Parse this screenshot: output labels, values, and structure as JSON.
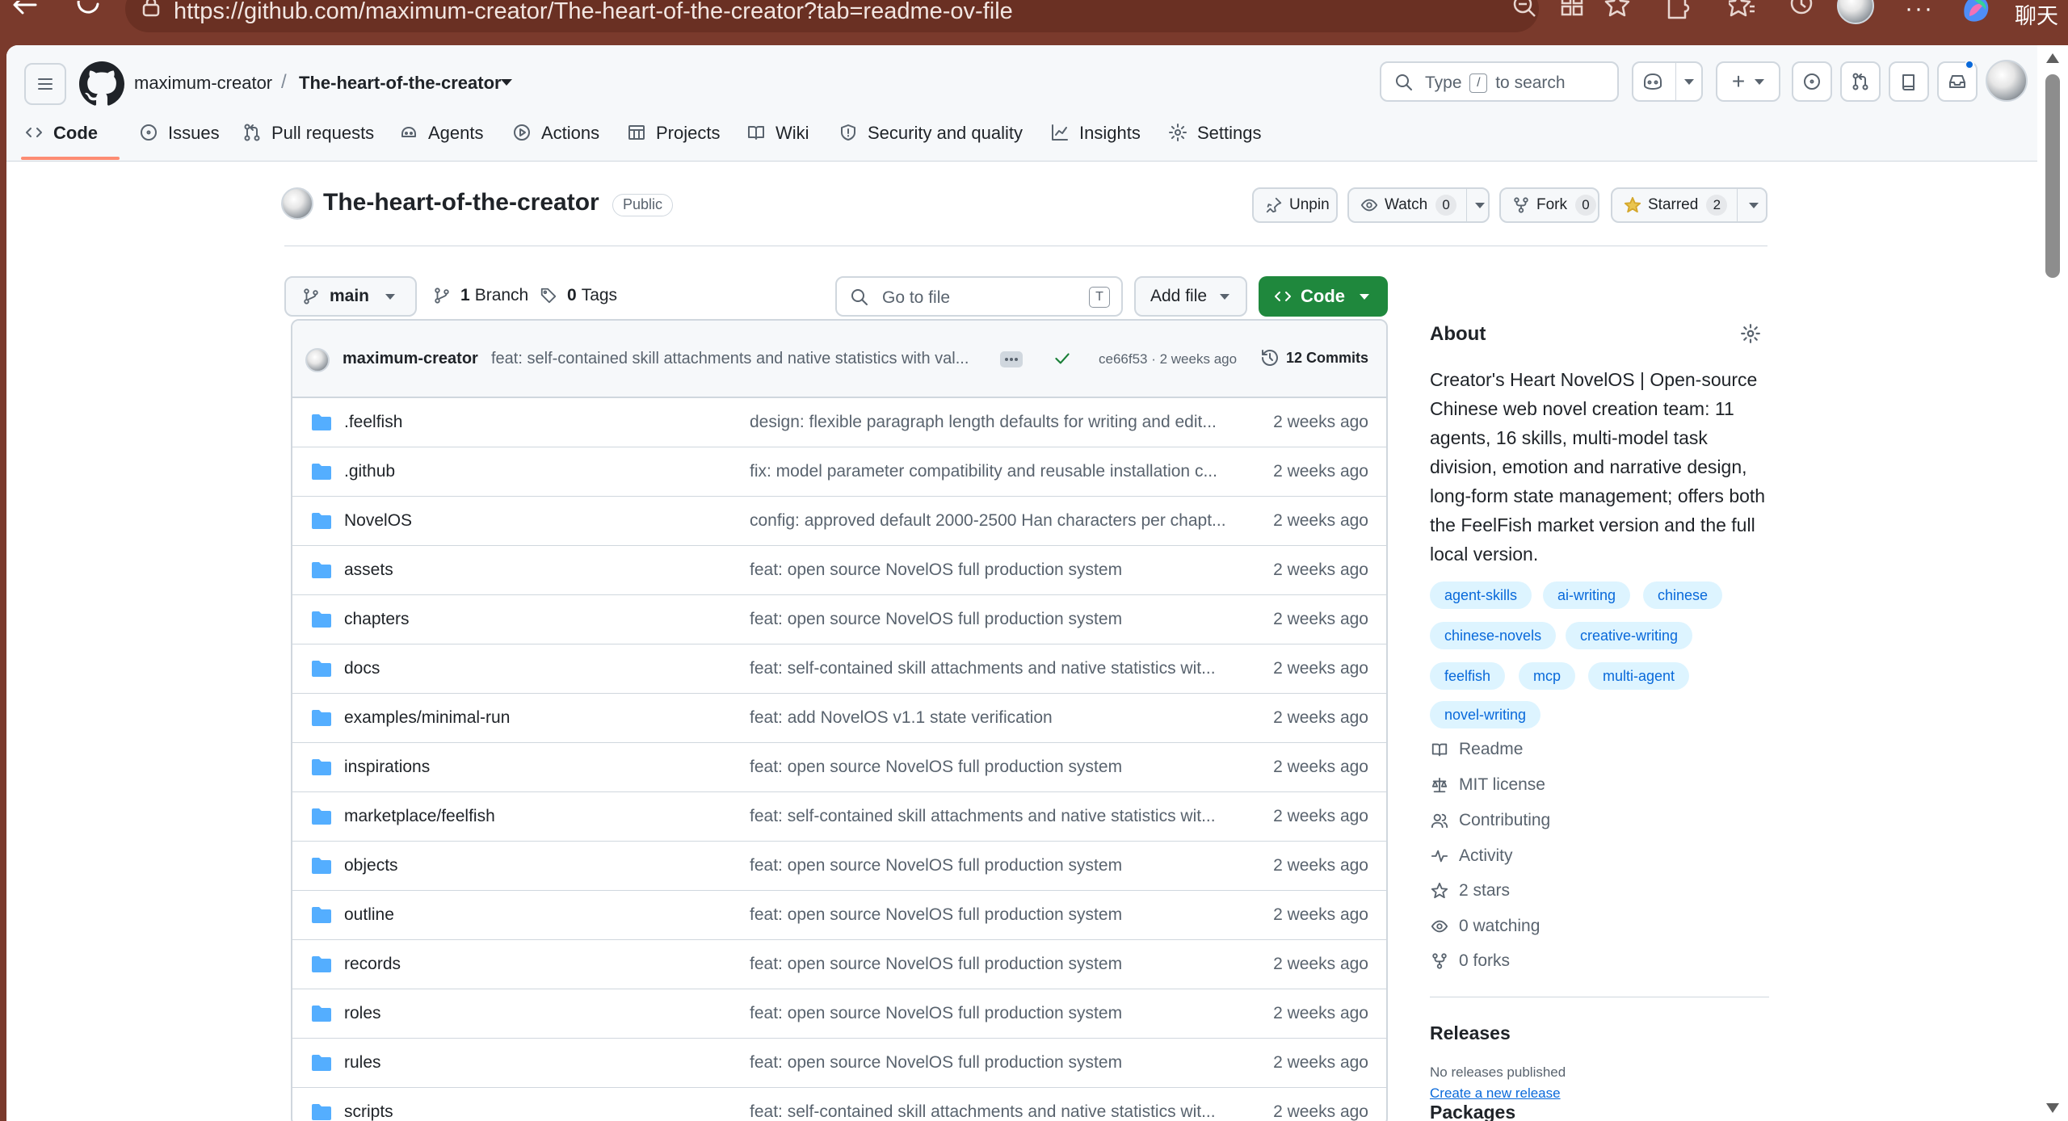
{
  "browser": {
    "url": "https://github.com/maximum-creator/The-heart-of-the-creator?tab=readme-ov-file",
    "chat_label": "聊天"
  },
  "header": {
    "owner": "maximum-creator",
    "separator": "/",
    "repo": "The-heart-of-the-creator",
    "search_prefix": "Type",
    "search_key": "/",
    "search_suffix": "to search"
  },
  "tabs": [
    {
      "label": "Code",
      "icon": "code-icon"
    },
    {
      "label": "Issues",
      "icon": "issue-icon"
    },
    {
      "label": "Pull requests",
      "icon": "pull-request-icon"
    },
    {
      "label": "Agents",
      "icon": "agents-icon"
    },
    {
      "label": "Actions",
      "icon": "play-icon"
    },
    {
      "label": "Projects",
      "icon": "table-icon"
    },
    {
      "label": "Wiki",
      "icon": "book-icon"
    },
    {
      "label": "Security and quality",
      "icon": "shield-icon"
    },
    {
      "label": "Insights",
      "icon": "graph-icon"
    },
    {
      "label": "Settings",
      "icon": "gear-icon"
    }
  ],
  "repo": {
    "title": "The-heart-of-the-creator",
    "visibility": "Public",
    "unpin_label": "Unpin",
    "watch_label": "Watch",
    "watch_count": "0",
    "fork_label": "Fork",
    "fork_count": "0",
    "starred_label": "Starred",
    "star_count": "2"
  },
  "branchbar": {
    "branch": "main",
    "branches": "1",
    "branches_label": "Branch",
    "tags": "0",
    "tags_label": "Tags",
    "goto_placeholder": "Go to file",
    "goto_key": "T",
    "add_file": "Add file",
    "code": "Code"
  },
  "latest_commit": {
    "user": "maximum-creator",
    "message": "feat: self-contained skill attachments and native statistics with val...",
    "hash": "ce66f53 · 2 weeks ago",
    "commits_count": "12",
    "commits_label": "Commits"
  },
  "files": [
    {
      "name": ".feelfish",
      "message": "design: flexible paragraph length defaults for writing and edit...",
      "time": "2 weeks ago"
    },
    {
      "name": ".github",
      "message": "fix: model parameter compatibility and reusable installation c...",
      "time": "2 weeks ago"
    },
    {
      "name": "NovelOS",
      "message": "config: approved default 2000-2500 Han characters per chapt...",
      "time": "2 weeks ago"
    },
    {
      "name": "assets",
      "message": "feat: open source NovelOS full production system",
      "time": "2 weeks ago"
    },
    {
      "name": "chapters",
      "message": "feat: open source NovelOS full production system",
      "time": "2 weeks ago"
    },
    {
      "name": "docs",
      "message": "feat: self-contained skill attachments and native statistics wit...",
      "time": "2 weeks ago"
    },
    {
      "name": "examples/minimal-run",
      "message": "feat: add NovelOS v1.1 state verification",
      "time": "2 weeks ago"
    },
    {
      "name": "inspirations",
      "message": "feat: open source NovelOS full production system",
      "time": "2 weeks ago"
    },
    {
      "name": "marketplace/feelfish",
      "message": "feat: self-contained skill attachments and native statistics wit...",
      "time": "2 weeks ago"
    },
    {
      "name": "objects",
      "message": "feat: open source NovelOS full production system",
      "time": "2 weeks ago"
    },
    {
      "name": "outline",
      "message": "feat: open source NovelOS full production system",
      "time": "2 weeks ago"
    },
    {
      "name": "records",
      "message": "feat: open source NovelOS full production system",
      "time": "2 weeks ago"
    },
    {
      "name": "roles",
      "message": "feat: open source NovelOS full production system",
      "time": "2 weeks ago"
    },
    {
      "name": "rules",
      "message": "feat: open source NovelOS full production system",
      "time": "2 weeks ago"
    },
    {
      "name": "scripts",
      "message": "feat: self-contained skill attachments and native statistics wit...",
      "time": "2 weeks ago"
    }
  ],
  "about": {
    "title": "About",
    "description": "Creator's Heart NovelOS | Open-source Chinese web novel creation team: 11 agents, 16 skills, multi-model task division, emotion and narrative design, long-form state management; offers both the FeelFish market version and the full local version.",
    "topics": [
      "agent-skills",
      "ai-writing",
      "chinese",
      "chinese-novels",
      "creative-writing",
      "feelfish",
      "mcp",
      "multi-agent",
      "novel-writing"
    ],
    "links": [
      {
        "label": "Readme",
        "icon": "book-icon"
      },
      {
        "label": "MIT license",
        "icon": "law-icon"
      },
      {
        "label": "Contributing",
        "icon": "people-icon"
      },
      {
        "label": "Activity",
        "icon": "pulse-icon"
      },
      {
        "label": "2 stars",
        "icon": "star-icon"
      },
      {
        "label": "0 watching",
        "icon": "eye-icon"
      },
      {
        "label": "0 forks",
        "icon": "fork-icon"
      }
    ]
  },
  "releases": {
    "title": "Releases",
    "none": "No releases published",
    "create_link": "Create a new release"
  },
  "packages": {
    "title": "Packages"
  },
  "colors": {
    "accent_green": "#1f883d",
    "link_blue": "#0969da",
    "folder_blue": "#54aeff",
    "tab_underline": "#fd8c73",
    "browser_frame": "#7a3a2c"
  }
}
